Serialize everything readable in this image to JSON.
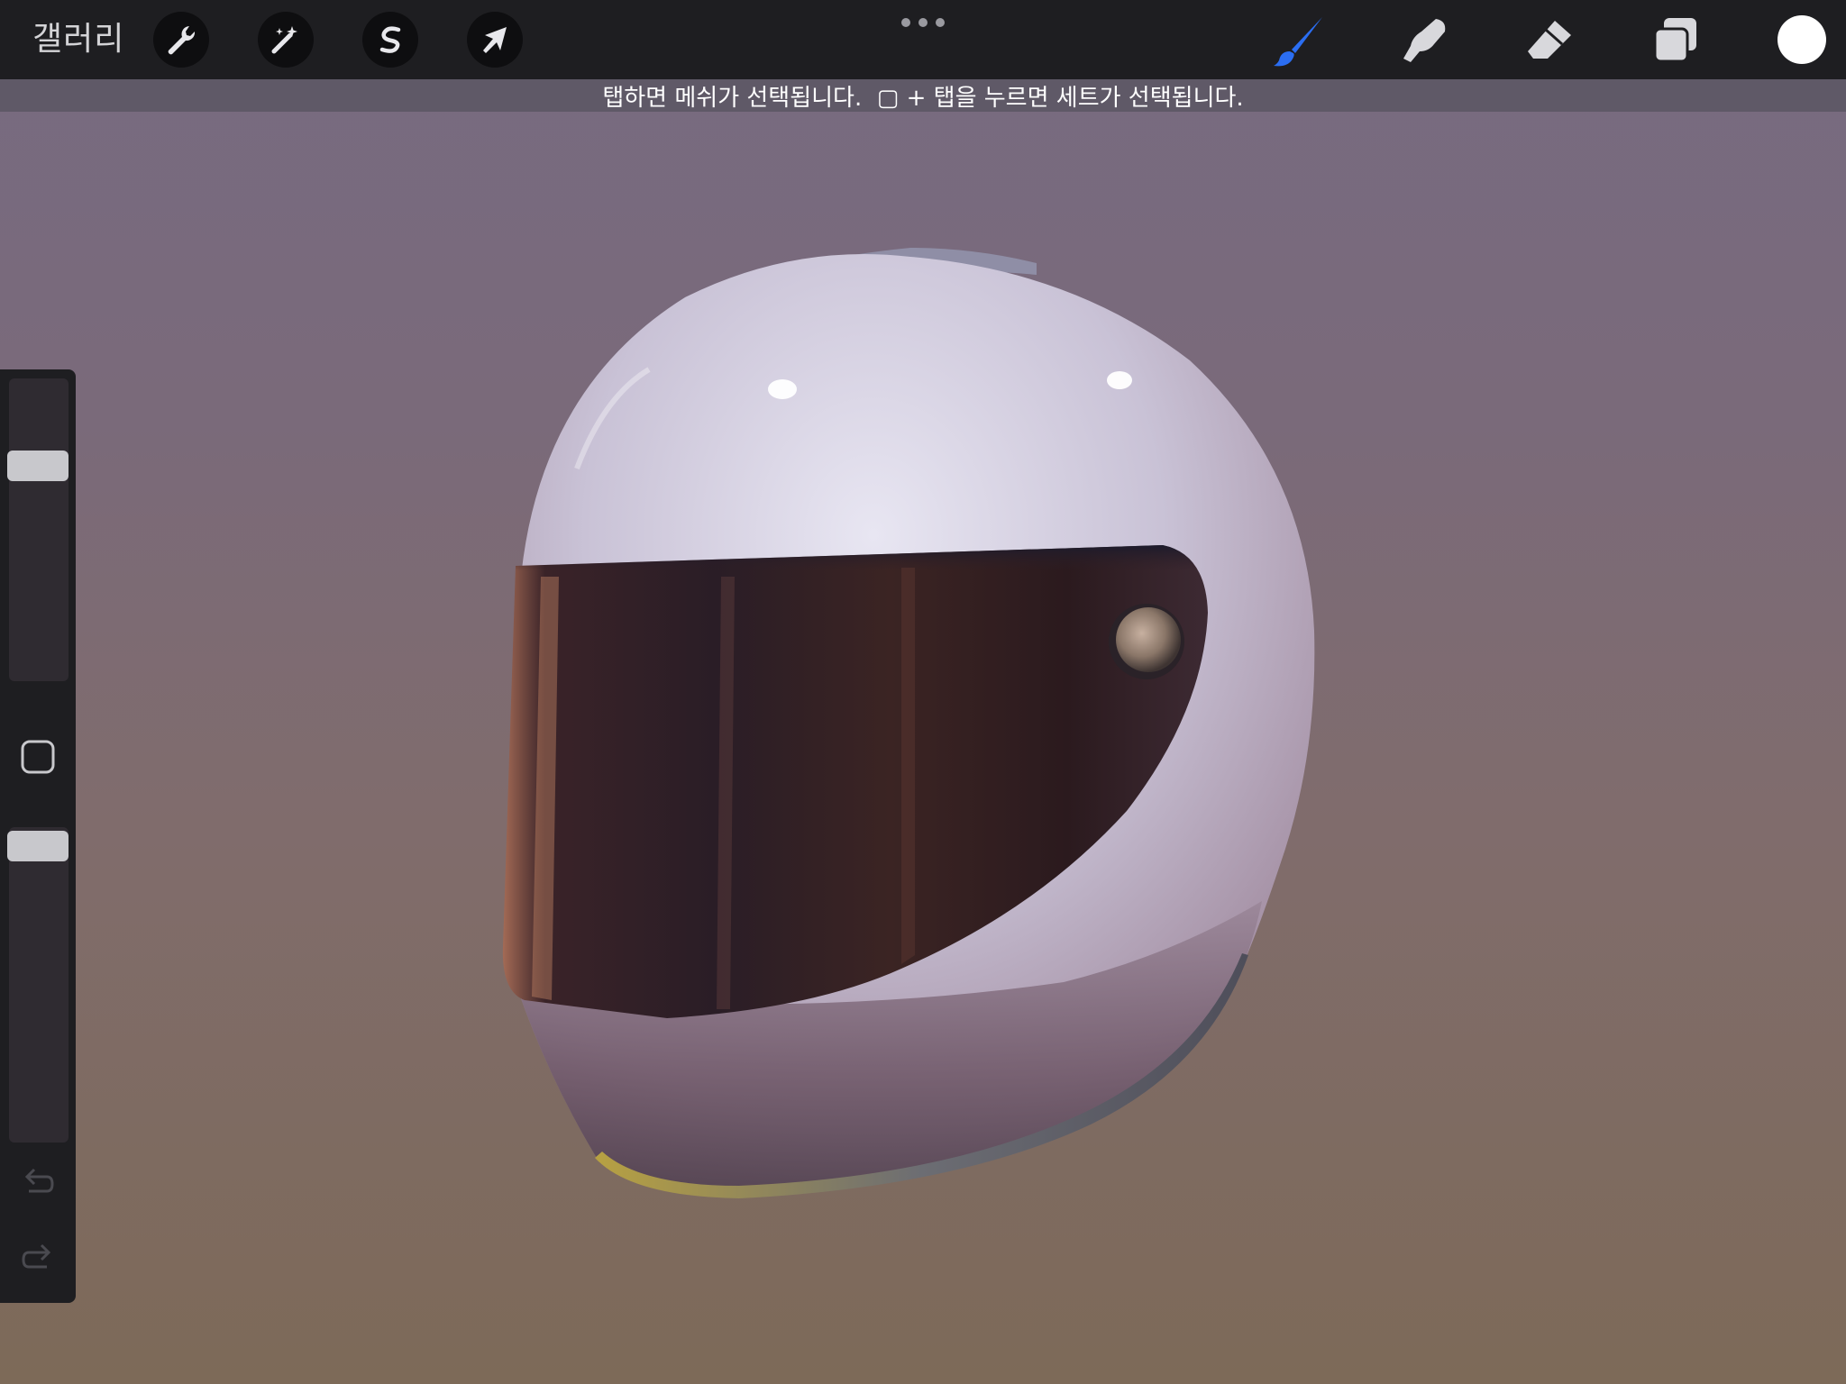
{
  "app": {
    "gallery_label": "갤러리"
  },
  "toolbar_left": [
    {
      "name": "actions-button",
      "icon": "wrench-icon"
    },
    {
      "name": "adjustments-button",
      "icon": "magic-wand-icon"
    },
    {
      "name": "selection-button",
      "icon": "selection-s-icon"
    },
    {
      "name": "transform-button",
      "icon": "arrow-cursor-icon"
    }
  ],
  "toolbar_right": [
    {
      "name": "brush-tool",
      "icon": "brush-icon",
      "active": true,
      "color": "#2b6ef2"
    },
    {
      "name": "smudge-tool",
      "icon": "smudge-finger-icon",
      "active": false,
      "color": "#d8d8dc"
    },
    {
      "name": "eraser-tool",
      "icon": "eraser-icon",
      "active": false,
      "color": "#d8d8dc"
    },
    {
      "name": "layers-button",
      "icon": "layers-icon",
      "active": false,
      "color": "#d8d8dc"
    }
  ],
  "current_color": "#ffffff",
  "hint": {
    "text": "탭하면 메쉬가 선택됩니다.  ▢ + 탭을 누르면 세트가 선택됩니다."
  },
  "sidebar": {
    "brush_size_label": "brush-size-slider",
    "opacity_label": "brush-opacity-slider",
    "modify_icon": "square-modify-icon",
    "undo_icon": "undo-icon",
    "redo_icon": "redo-icon"
  },
  "colors": {
    "topbar": "#1e1e21",
    "accent": "#2b6ef2"
  }
}
